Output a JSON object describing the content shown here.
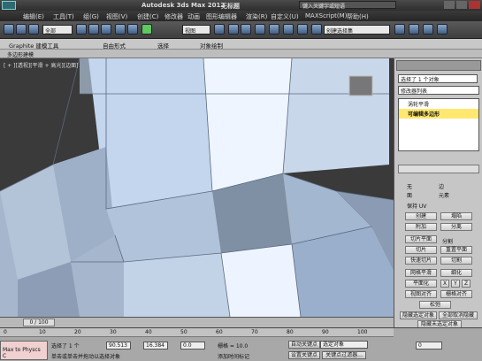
{
  "title": {
    "app": "Autodesk 3ds Max 2012",
    "file": "无标题",
    "search_placeholder": "键入关键字或短语"
  },
  "menu": [
    "编辑(E)",
    "工具(T)",
    "组(G)",
    "视图(V)",
    "创建(C)",
    "修改器",
    "动画",
    "图形编辑器",
    "渲染(R)",
    "自定义(U)",
    "MAXScript(M)",
    "帮助(H)"
  ],
  "toolbar": {
    "selection_filter": "全部",
    "ref_coord": "视图",
    "named_sel": "创建选择集"
  },
  "ribbon": {
    "tabs": [
      "Graphite 建模工具",
      "自由形式",
      "选择",
      "对象绘制"
    ],
    "subtab": "多边形建模"
  },
  "viewport": {
    "label": "[ + ][透视][平滑 + 高光][边面]"
  },
  "panel": {
    "sel_text": "选择了 1 个对象",
    "modifier_list": "修改器列表",
    "stack": [
      "涡轮平滑",
      "可编辑多边形"
    ],
    "radio_none": "无",
    "radio_edge": "边",
    "radio_face": "面",
    "radio_element": "元素",
    "preserve_uv": "保持 UV",
    "create": "创建",
    "collapse": "塌陷",
    "attach": "附加",
    "detach": "分离",
    "slice_plane": "切片平面",
    "split": "分割",
    "slice": "切片",
    "reset_plane": "重置平面",
    "quickslice": "快速切片",
    "cut": "切割",
    "msmooth": "网格平滑",
    "tessellate": "细化",
    "make_planar": "平面化",
    "x": "X",
    "y": "Y",
    "z": "Z",
    "view_align": "视图对齐",
    "grid_align": "栅格对齐",
    "relax": "松弛",
    "hide_sel": "隐藏选定对象",
    "unhide_all": "全部取消隐藏",
    "hide_unsel": "隐藏未选定对象"
  },
  "timeline": {
    "frame": "0 / 100",
    "ticks": [
      "0",
      "10",
      "20",
      "30",
      "40",
      "50",
      "60",
      "70",
      "80",
      "90",
      "100"
    ]
  },
  "status": {
    "maxscript": "Max to Physcs C",
    "selected": "选择了 1 个",
    "x": "90.513",
    "y": "16.384",
    "z": "0.0",
    "grid": "栅格 = 10.0",
    "hint": "单击或单击并拖动以选择对象",
    "add_tag": "添加时间标记",
    "autokey": "自动关键点",
    "selected_obj": "选定对象",
    "setkey": "设置关键点",
    "key_filters": "关键点过滤器...",
    "frame_val": "0"
  }
}
